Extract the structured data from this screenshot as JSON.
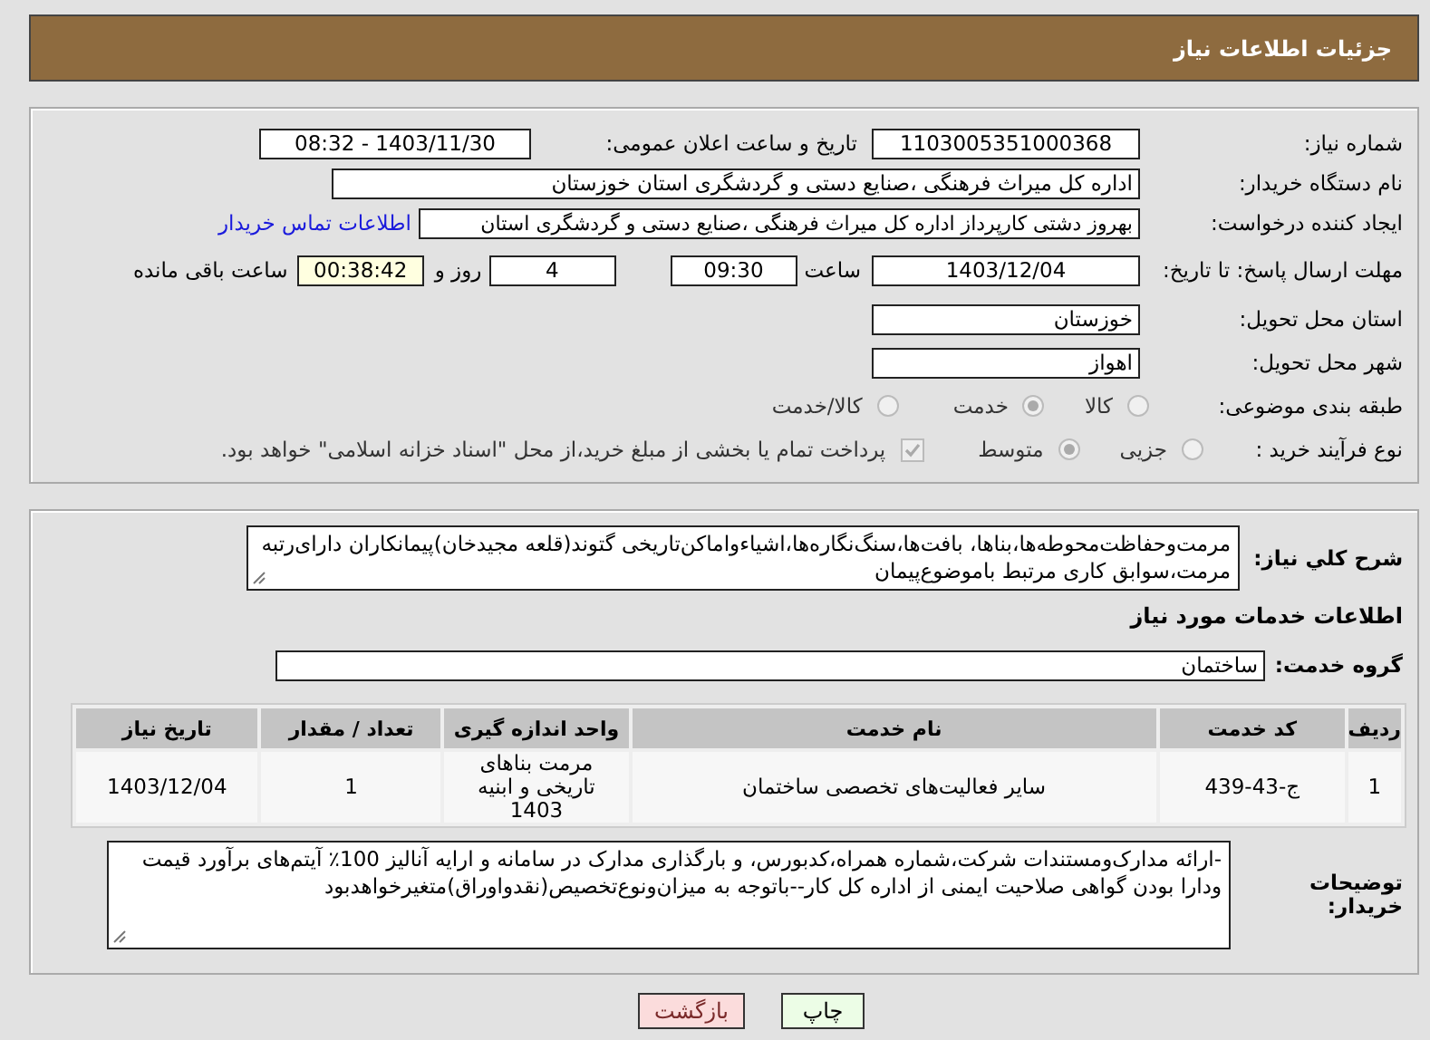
{
  "header": {
    "title": "جزئیات اطلاعات نیاز"
  },
  "need_number": {
    "label": "شماره نیاز:",
    "value": "1103005351000368"
  },
  "announce": {
    "label": "تاریخ و ساعت اعلان عمومی:",
    "value": "1403/11/30 - 08:32"
  },
  "buyer": {
    "label": "نام دستگاه خریدار:",
    "value": "اداره کل میراث فرهنگی ،صنایع دستی و گردشگری استان خوزستان"
  },
  "requester": {
    "label": "ایجاد کننده درخواست:",
    "value": "بهروز دشتی کارپرداز اداره کل میراث فرهنگی ،صنایع دستی و گردشگری استان",
    "link": "اطلاعات تماس خریدار"
  },
  "deadline": {
    "label": "مهلت ارسال پاسخ: تا تاریخ:",
    "date": "1403/12/04",
    "time_label": "ساعت",
    "time": "09:30",
    "days": "4",
    "days_label": "روز و",
    "remaining": "00:38:42",
    "remaining_label": "ساعت باقی مانده"
  },
  "province": {
    "label": "استان محل تحویل:",
    "value": "خوزستان"
  },
  "city": {
    "label": "شهر محل تحویل:",
    "value": "اهواز"
  },
  "category": {
    "label": "طبقه بندی موضوعی:",
    "options": [
      {
        "label": "کالا",
        "selected": false
      },
      {
        "label": "خدمت",
        "selected": true
      },
      {
        "label": "کالا/خدمت",
        "selected": false
      }
    ]
  },
  "process": {
    "label": "نوع فرآیند خرید :",
    "options": [
      {
        "label": "جزیی",
        "selected": false
      },
      {
        "label": "متوسط",
        "selected": true
      }
    ],
    "payment": {
      "checked": true,
      "text": "پرداخت تمام یا بخشی از مبلغ خرید،از محل \"اسناد خزانه اسلامی\" خواهد بود."
    }
  },
  "description": {
    "label": "شرح کلي نياز:",
    "text": "مرمت‌وحفاظت‌محوطه‌ها،بناها، بافت‌ها،سنگ‌نگاره‌ها،اشیاءواماکن‌تاریخی گتوند(قلعه مجیدخان)پیمانکاران دارای‌رتبه مرمت،سوابق کاری مرتبط باموضوع‌پیمان"
  },
  "services_title": "اطلاعات خدمات مورد نیاز",
  "group": {
    "label": "گروه خدمت:",
    "value": "ساختمان"
  },
  "table": {
    "columns": [
      "ردیف",
      "کد خدمت",
      "نام خدمت",
      "واحد اندازه گیری",
      "تعداد / مقدار",
      "تاریخ نیاز"
    ],
    "rows": [
      [
        "1",
        "ج-43-439",
        "سایر فعالیت‌های تخصصی ساختمان",
        "مرمت بناهای تاریخی و ابنیه 1403",
        "1",
        "1403/12/04"
      ]
    ]
  },
  "notes": {
    "label": "توضیحات خریدار:",
    "text": "-ارائه مدارک‌ومستندات شرکت،شماره همراه،کدبورس، و بارگذاری مدارک در سامانه و ارایه آنالیز 100٪ آیتم‌های برآورد قیمت ودارا بودن گواهی صلاحیت ایمنی از اداره کل کار--باتوجه به میزان‌ونوع‌تخصیص(نقدواوراق)متغیرخواهدبود"
  },
  "buttons": [
    {
      "label": "چاپ",
      "kind": "print"
    },
    {
      "label": "بازگشت",
      "kind": "back"
    }
  ]
}
